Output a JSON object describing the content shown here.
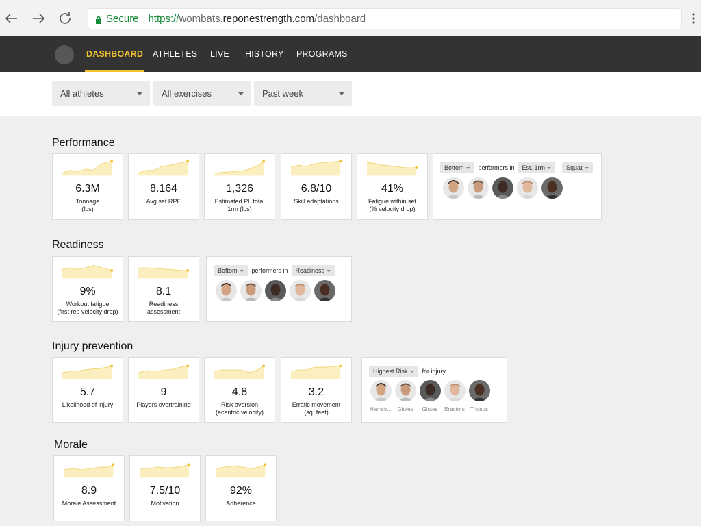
{
  "browser": {
    "secure_label": "Secure",
    "url_scheme": "https://",
    "url_sub": "wombats.",
    "url_host": "reponestrength.com",
    "url_path": "/dashboard"
  },
  "nav": {
    "tabs": [
      "DASHBOARD",
      "ATHLETES",
      "LIVE",
      "HISTORY",
      "PROGRAMS"
    ],
    "active": "DASHBOARD",
    "accent": "#f0c230"
  },
  "filters": {
    "athletes": "All athletes",
    "exercises": "All exercises",
    "period": "Past week"
  },
  "sections": {
    "performance": {
      "title": "Performance",
      "metrics": [
        {
          "value": "6.3M",
          "label": "Tonnage\n(lbs)"
        },
        {
          "value": "8.164",
          "label": "Avg set RPE"
        },
        {
          "value": "1,326",
          "label": "Estimated PL total\n1rm (lbs)"
        },
        {
          "value": "6.8/10",
          "label": "Skill adaptations"
        },
        {
          "value": "41%",
          "label": "Fatigue within set\n(% velocity drop)"
        }
      ],
      "performers": {
        "rank": "Bottom",
        "text": "performers in",
        "metric": "Est. 1rm",
        "exercise": "Squat"
      }
    },
    "readiness": {
      "title": "Readiness",
      "metrics": [
        {
          "value": "9%",
          "label": "Workout fatigue\n(first rep velocity drop)"
        },
        {
          "value": "8.1",
          "label": "Readiness\nassessment"
        }
      ],
      "performers": {
        "rank": "Bottom",
        "text": "performers in",
        "metric": "Readiness"
      }
    },
    "injury": {
      "title": "Injury prevention",
      "metrics": [
        {
          "value": "5.7",
          "label": "Likelihood of injury"
        },
        {
          "value": "9",
          "label": "Players overtraining"
        },
        {
          "value": "4.8",
          "label": "Risk aversion\n(ecentric velocity)"
        },
        {
          "value": "3.2",
          "label": "Erratic movement\n(sq. feet)"
        }
      ],
      "risk": {
        "rank": "Highest Risk",
        "text": "for injury",
        "labels": [
          "Hamstr...",
          "Glutes",
          "Glutes",
          "Erectors",
          "Triceps"
        ]
      }
    },
    "morale": {
      "title": "Morale",
      "metrics": [
        {
          "value": "8.9",
          "label": "Morale Assessment"
        },
        {
          "value": "7.5/10",
          "label": "Motivation"
        },
        {
          "value": "92%",
          "label": "Adherence"
        }
      ]
    }
  },
  "colors": {
    "spark_fill": "#fbeebf",
    "spark_line": "#f2d67a",
    "spark_dot": "#f0c230"
  }
}
